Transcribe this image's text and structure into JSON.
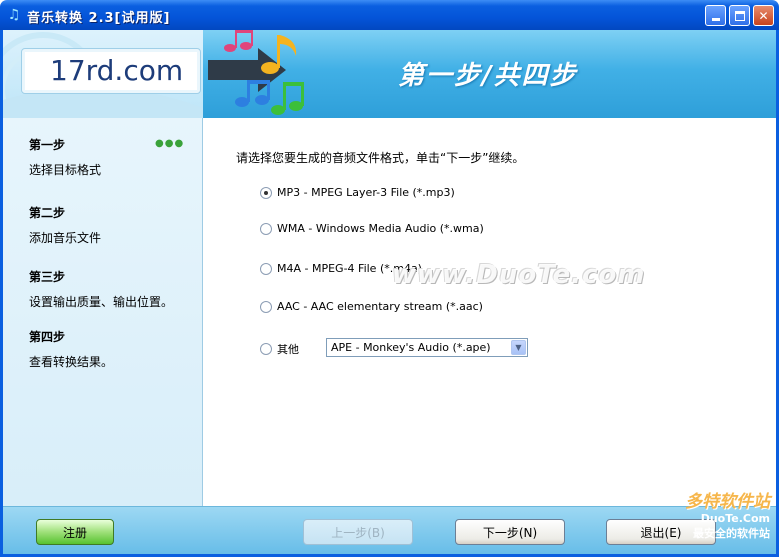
{
  "window": {
    "title": "音乐转换 2.3[试用版]",
    "app_icon": "music-note-icon",
    "buttons": [
      "minimize",
      "maximize",
      "close"
    ]
  },
  "header": {
    "logo": "17rd.com",
    "step_banner": "第一步/共四步"
  },
  "steps": [
    {
      "title": "第一步",
      "desc": "选择目标格式"
    },
    {
      "title": "第二步",
      "desc": "添加音乐文件"
    },
    {
      "title": "第三步",
      "desc": "设置输出质量、输出位置。"
    },
    {
      "title": "第四步",
      "desc": "查看转换结果。"
    }
  ],
  "main": {
    "prompt": "请选择您要生成的音频文件格式，单击“下一步”继续。",
    "options": [
      {
        "label": "MP3 - MPEG Layer-3 File (*.mp3)",
        "selected": true
      },
      {
        "label": "WMA - Windows Media Audio (*.wma)",
        "selected": false
      },
      {
        "label": "M4A - MPEG-4 File (*.m4a)",
        "selected": false
      },
      {
        "label": "AAC - AAC elementary stream (*.aac)",
        "selected": false
      },
      {
        "label": "其他",
        "selected": false
      }
    ],
    "other_select_value": "APE - Monkey's Audio (*.ape)",
    "watermark": "www.DuoTe.com"
  },
  "footer": {
    "register": "注册",
    "prev": "上一步(B)",
    "next": "下一步(N)",
    "exit": "退出(E)",
    "brand_line1": "多特软件站",
    "brand_line2": "DuoTe.Com",
    "brand_line3": "最安全的软件站"
  }
}
